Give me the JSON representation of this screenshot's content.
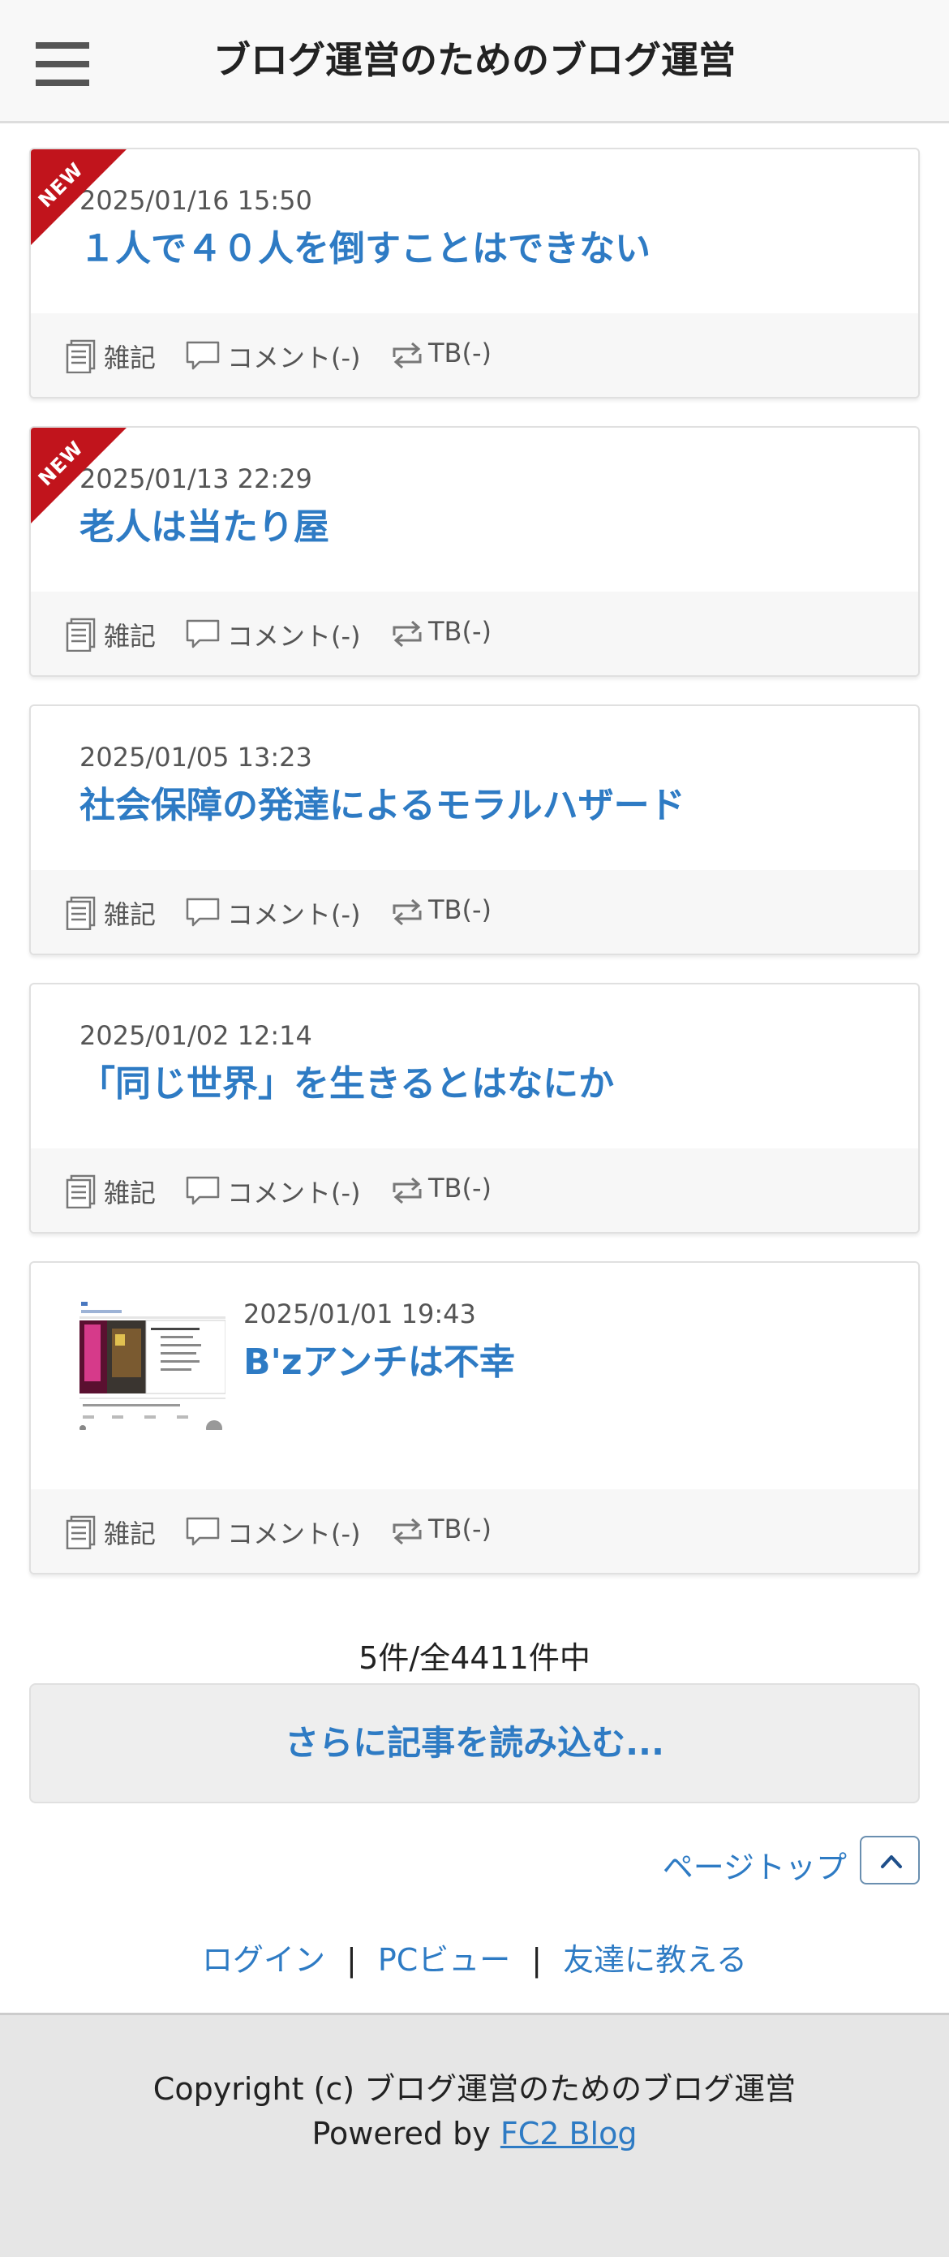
{
  "header": {
    "title": "ブログ運営のためのブログ運営"
  },
  "posts": [
    {
      "date": "2025/01/16 15:50",
      "title": "１人で４０人を倒すことはできない",
      "badge": "NEW",
      "category": "雑記",
      "comment": "コメント(-)",
      "tb": "TB(-)"
    },
    {
      "date": "2025/01/13 22:29",
      "title": "老人は当たり屋",
      "badge": "NEW",
      "category": "雑記",
      "comment": "コメント(-)",
      "tb": "TB(-)"
    },
    {
      "date": "2025/01/05 13:23",
      "title": "社会保障の発達によるモラルハザード",
      "category": "雑記",
      "comment": "コメント(-)",
      "tb": "TB(-)"
    },
    {
      "date": "2025/01/02 12:14",
      "title": "「同じ世界」を生きるとはなにか",
      "category": "雑記",
      "comment": "コメント(-)",
      "tb": "TB(-)"
    },
    {
      "date": "2025/01/01 19:43",
      "title": "B'zアンチは不幸",
      "category": "雑記",
      "comment": "コメント(-)",
      "tb": "TB(-)"
    }
  ],
  "pagination": {
    "count": "5件/全4411件中",
    "load_more": "さらに記事を読み込む..."
  },
  "pagetop": {
    "label": "ページトップ"
  },
  "footer_links": {
    "login": "ログイン",
    "separator": "|",
    "pc_view": "PCビュー",
    "tell_friend": "友達に教える"
  },
  "footer": {
    "copyright": "Copyright (c) ブログ運営のためのブログ運営",
    "powered_prefix": "Powered by",
    "powered_link": "FC2 Blog"
  },
  "colors": {
    "accent": "#2e7bc4",
    "badge": "#c1141c",
    "header_bg": "#f8f8f8",
    "footer_bg": "#e6e6e6"
  }
}
